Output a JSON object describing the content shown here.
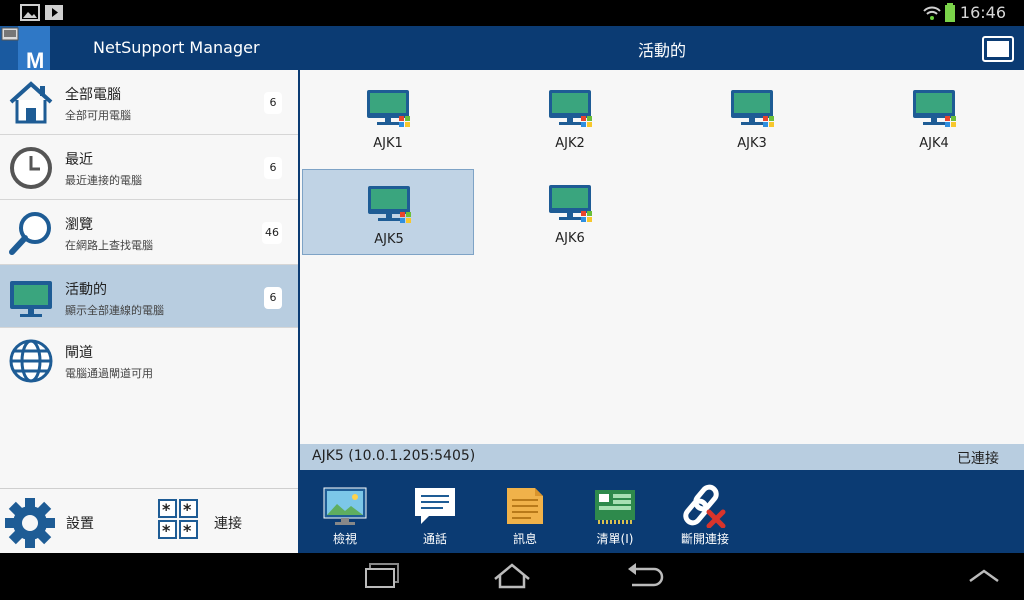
{
  "status_bar": {
    "time": "16:46"
  },
  "app": {
    "title": "NetSupport Manager"
  },
  "sidebar": {
    "items": [
      {
        "title": "全部電腦",
        "subtitle": "全部可用電腦",
        "count": "6"
      },
      {
        "title": "最近",
        "subtitle": "最近連接的電腦",
        "count": "6"
      },
      {
        "title": "瀏覽",
        "subtitle": "在網路上查找電腦",
        "count": "46"
      },
      {
        "title": "活動的",
        "subtitle": "顯示全部連線的電腦",
        "count": "6"
      },
      {
        "title": "閘道",
        "subtitle": "電腦通過閘道可用",
        "count": ""
      }
    ],
    "selected_index": 3,
    "settings_label": "設置",
    "connect_label": "連接"
  },
  "main": {
    "title": "活動的",
    "computers": [
      "AJK1",
      "AJK2",
      "AJK3",
      "AJK4",
      "AJK5",
      "AJK6"
    ],
    "selected_computer": "AJK5",
    "info": {
      "address": "AJK5 (10.0.1.205:5405)",
      "status": "已連接"
    },
    "toolbar": {
      "view_label": "檢視",
      "chat_label": "通話",
      "message_label": "訊息",
      "inventory_label": "清單(I)",
      "disconnect_label": "斷開連接"
    }
  },
  "colors": {
    "header": "#0b3b73",
    "selection": "#b8cde0",
    "monitor_screen": "#3aa57e",
    "monitor_frame": "#1e5c95"
  }
}
